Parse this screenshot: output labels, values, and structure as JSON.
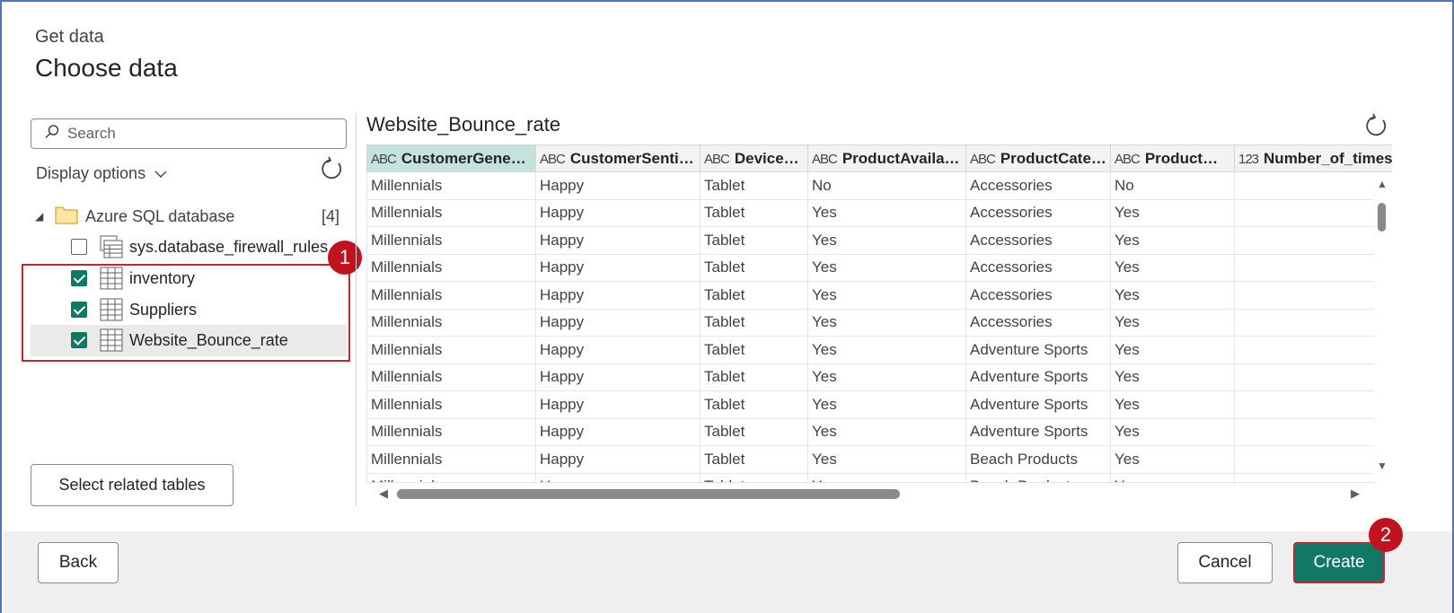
{
  "header": {
    "subtitle": "Get data",
    "title": "Choose data"
  },
  "navigator": {
    "search_placeholder": "Search",
    "display_options_label": "Display options",
    "source": {
      "name": "Azure SQL database",
      "count": "[4]"
    },
    "items": [
      {
        "label": "sys.database_firewall_rules",
        "checked": false,
        "kind": "view"
      },
      {
        "label": "inventory",
        "checked": true,
        "kind": "table"
      },
      {
        "label": "Suppliers",
        "checked": true,
        "kind": "table"
      },
      {
        "label": "Website_Bounce_rate",
        "checked": true,
        "kind": "table",
        "selected": true
      }
    ],
    "select_related_label": "Select related tables"
  },
  "annotations": {
    "badge1": "1",
    "badge2": "2"
  },
  "preview": {
    "title": "Website_Bounce_rate",
    "columns": [
      {
        "type": "ABC",
        "name": "CustomerGenerati..."
      },
      {
        "type": "ABC",
        "name": "CustomerSentime..."
      },
      {
        "type": "ABC",
        "name": "DeviceType"
      },
      {
        "type": "ABC",
        "name": "ProductAvailability"
      },
      {
        "type": "ABC",
        "name": "ProductCatego..."
      },
      {
        "type": "ABC",
        "name": "ProductMat..."
      },
      {
        "type": "123",
        "name": "Number_of_times_p"
      }
    ],
    "rows": [
      [
        "Millennials",
        "Happy",
        "Tablet",
        "No",
        "Accessories",
        "No",
        ""
      ],
      [
        "Millennials",
        "Happy",
        "Tablet",
        "Yes",
        "Accessories",
        "Yes",
        ""
      ],
      [
        "Millennials",
        "Happy",
        "Tablet",
        "Yes",
        "Accessories",
        "Yes",
        ""
      ],
      [
        "Millennials",
        "Happy",
        "Tablet",
        "Yes",
        "Accessories",
        "Yes",
        ""
      ],
      [
        "Millennials",
        "Happy",
        "Tablet",
        "Yes",
        "Accessories",
        "Yes",
        ""
      ],
      [
        "Millennials",
        "Happy",
        "Tablet",
        "Yes",
        "Accessories",
        "Yes",
        ""
      ],
      [
        "Millennials",
        "Happy",
        "Tablet",
        "Yes",
        "Adventure Sports",
        "Yes",
        ""
      ],
      [
        "Millennials",
        "Happy",
        "Tablet",
        "Yes",
        "Adventure Sports",
        "Yes",
        ""
      ],
      [
        "Millennials",
        "Happy",
        "Tablet",
        "Yes",
        "Adventure Sports",
        "Yes",
        ""
      ],
      [
        "Millennials",
        "Happy",
        "Tablet",
        "Yes",
        "Adventure Sports",
        "Yes",
        ""
      ],
      [
        "Millennials",
        "Happy",
        "Tablet",
        "Yes",
        "Beach Products",
        "Yes",
        ""
      ],
      [
        "Millennials",
        "Happy",
        "Tablet",
        "Yes",
        "Beach Products",
        "Yes",
        ""
      ]
    ]
  },
  "footer": {
    "back_label": "Back",
    "cancel_label": "Cancel",
    "create_label": "Create"
  },
  "colors": {
    "accent": "#117865",
    "annotation_red": "#c1121f",
    "active_header": "#c5e3de"
  }
}
